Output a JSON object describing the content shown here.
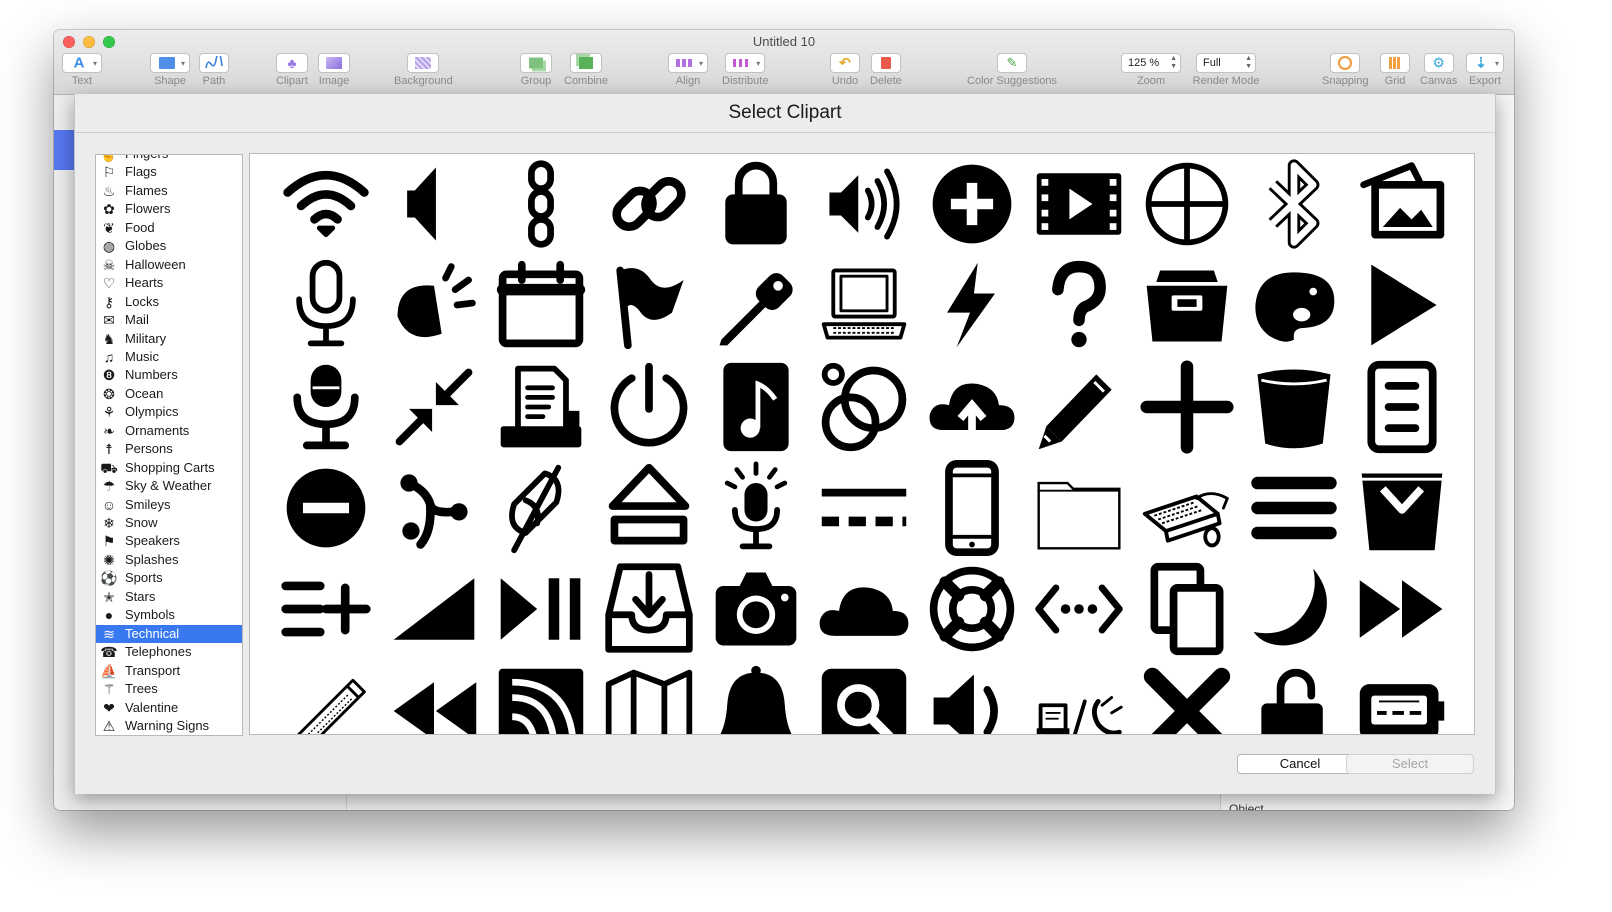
{
  "window": {
    "title": "Untitled 10"
  },
  "toolbar": {
    "text": "Text",
    "shape": "Shape",
    "path": "Path",
    "clipart": "Clipart",
    "image": "Image",
    "background": "Background",
    "group": "Group",
    "combine": "Combine",
    "align": "Align",
    "distribute": "Distribute",
    "undo": "Undo",
    "delete": "Delete",
    "color_suggestions": "Color Suggestions",
    "zoom_label": "Zoom",
    "zoom_value": "125 %",
    "render_mode_label": "Render Mode",
    "render_mode_value": "Full",
    "snapping": "Snapping",
    "grid": "Grid",
    "canvas": "Canvas",
    "export": "Export"
  },
  "sheet": {
    "title": "Select Clipart",
    "cancel": "Cancel",
    "select": "Select"
  },
  "background": {
    "object_label": "Object"
  },
  "categories": [
    {
      "label": "Fingers",
      "icon": "finger-icon"
    },
    {
      "label": "Flags",
      "icon": "flag-icon"
    },
    {
      "label": "Flames",
      "icon": "flame-icon"
    },
    {
      "label": "Flowers",
      "icon": "flower-icon"
    },
    {
      "label": "Food",
      "icon": "cherries-icon"
    },
    {
      "label": "Globes",
      "icon": "globe-icon"
    },
    {
      "label": "Halloween",
      "icon": "halloween-icon"
    },
    {
      "label": "Hearts",
      "icon": "heart-icon"
    },
    {
      "label": "Locks",
      "icon": "key-icon"
    },
    {
      "label": "Mail",
      "icon": "envelope-icon"
    },
    {
      "label": "Military",
      "icon": "soldier-icon"
    },
    {
      "label": "Music",
      "icon": "music-note-icon"
    },
    {
      "label": "Numbers",
      "icon": "number-eight-icon"
    },
    {
      "label": "Ocean",
      "icon": "fish-icon"
    },
    {
      "label": "Olympics",
      "icon": "athletes-icon"
    },
    {
      "label": "Ornaments",
      "icon": "ornament-icon"
    },
    {
      "label": "Persons",
      "icon": "person-icon"
    },
    {
      "label": "Shopping Carts",
      "icon": "shopping-cart-icon"
    },
    {
      "label": "Sky & Weather",
      "icon": "umbrella-icon"
    },
    {
      "label": "Smileys",
      "icon": "smiley-icon"
    },
    {
      "label": "Snow",
      "icon": "snowflake-icon"
    },
    {
      "label": "Speakers",
      "icon": "megaphone-icon"
    },
    {
      "label": "Splashes",
      "icon": "splash-icon"
    },
    {
      "label": "Sports",
      "icon": "sports-icon"
    },
    {
      "label": "Stars",
      "icon": "star-icon"
    },
    {
      "label": "Symbols",
      "icon": "bomb-icon"
    },
    {
      "label": "Technical",
      "icon": "wifi-icon",
      "selected": true
    },
    {
      "label": "Telephones",
      "icon": "telephone-icon"
    },
    {
      "label": "Transport",
      "icon": "sailboat-icon"
    },
    {
      "label": "Trees",
      "icon": "palm-tree-icon"
    },
    {
      "label": "Valentine",
      "icon": "hearts-icon"
    },
    {
      "label": "Warning Signs",
      "icon": "warning-triangle-icon"
    }
  ],
  "cliparts": [
    "wifi-icon",
    "speaker-icon",
    "chain-icon",
    "link-icon",
    "lock-icon",
    "volume-high-icon",
    "plus-circle-icon",
    "video-frame-icon",
    "crosshair-circle-icon",
    "bluetooth-icon",
    "image-stack-icon",
    "microphone-icon",
    "speaker-sound-icon",
    "calendar-icon",
    "flag-icon",
    "flashlight-icon",
    "laptop-icon",
    "lightning-icon",
    "question-mark-icon",
    "archive-box-icon",
    "palette-icon",
    "play-icon",
    "studio-microphone-icon",
    "collapse-arrows-icon",
    "printer-icon",
    "power-icon",
    "music-file-icon",
    "rings-icon",
    "cloud-upload-icon",
    "pencil-icon",
    "plus-icon",
    "bucket-icon",
    "document-list-icon",
    "minus-circle-icon",
    "branch-icon",
    "mute-icon",
    "eject-icon",
    "microphone-light-icon",
    "dashed-line-icon",
    "smartphone-icon",
    "folder-icon",
    "keyboard-mouse-icon",
    "hamburger-menu-icon",
    "inbox-tray-icon",
    "add-list-icon",
    "volume-wedge-icon",
    "play-pause-icon",
    "download-tray-icon",
    "camera-icon",
    "cloud-icon",
    "lifebuoy-icon",
    "code-dots-icon",
    "copy-icon",
    "moon-icon",
    "fast-forward-icon",
    "pencil-sketch-icon",
    "rewind-icon",
    "rss-feed-icon",
    "map-icon",
    "bell-icon",
    "search-icon",
    "volume-low-icon",
    "print-fax-icon",
    "x-mark-icon",
    "unlock-icon",
    "pager-icon"
  ]
}
